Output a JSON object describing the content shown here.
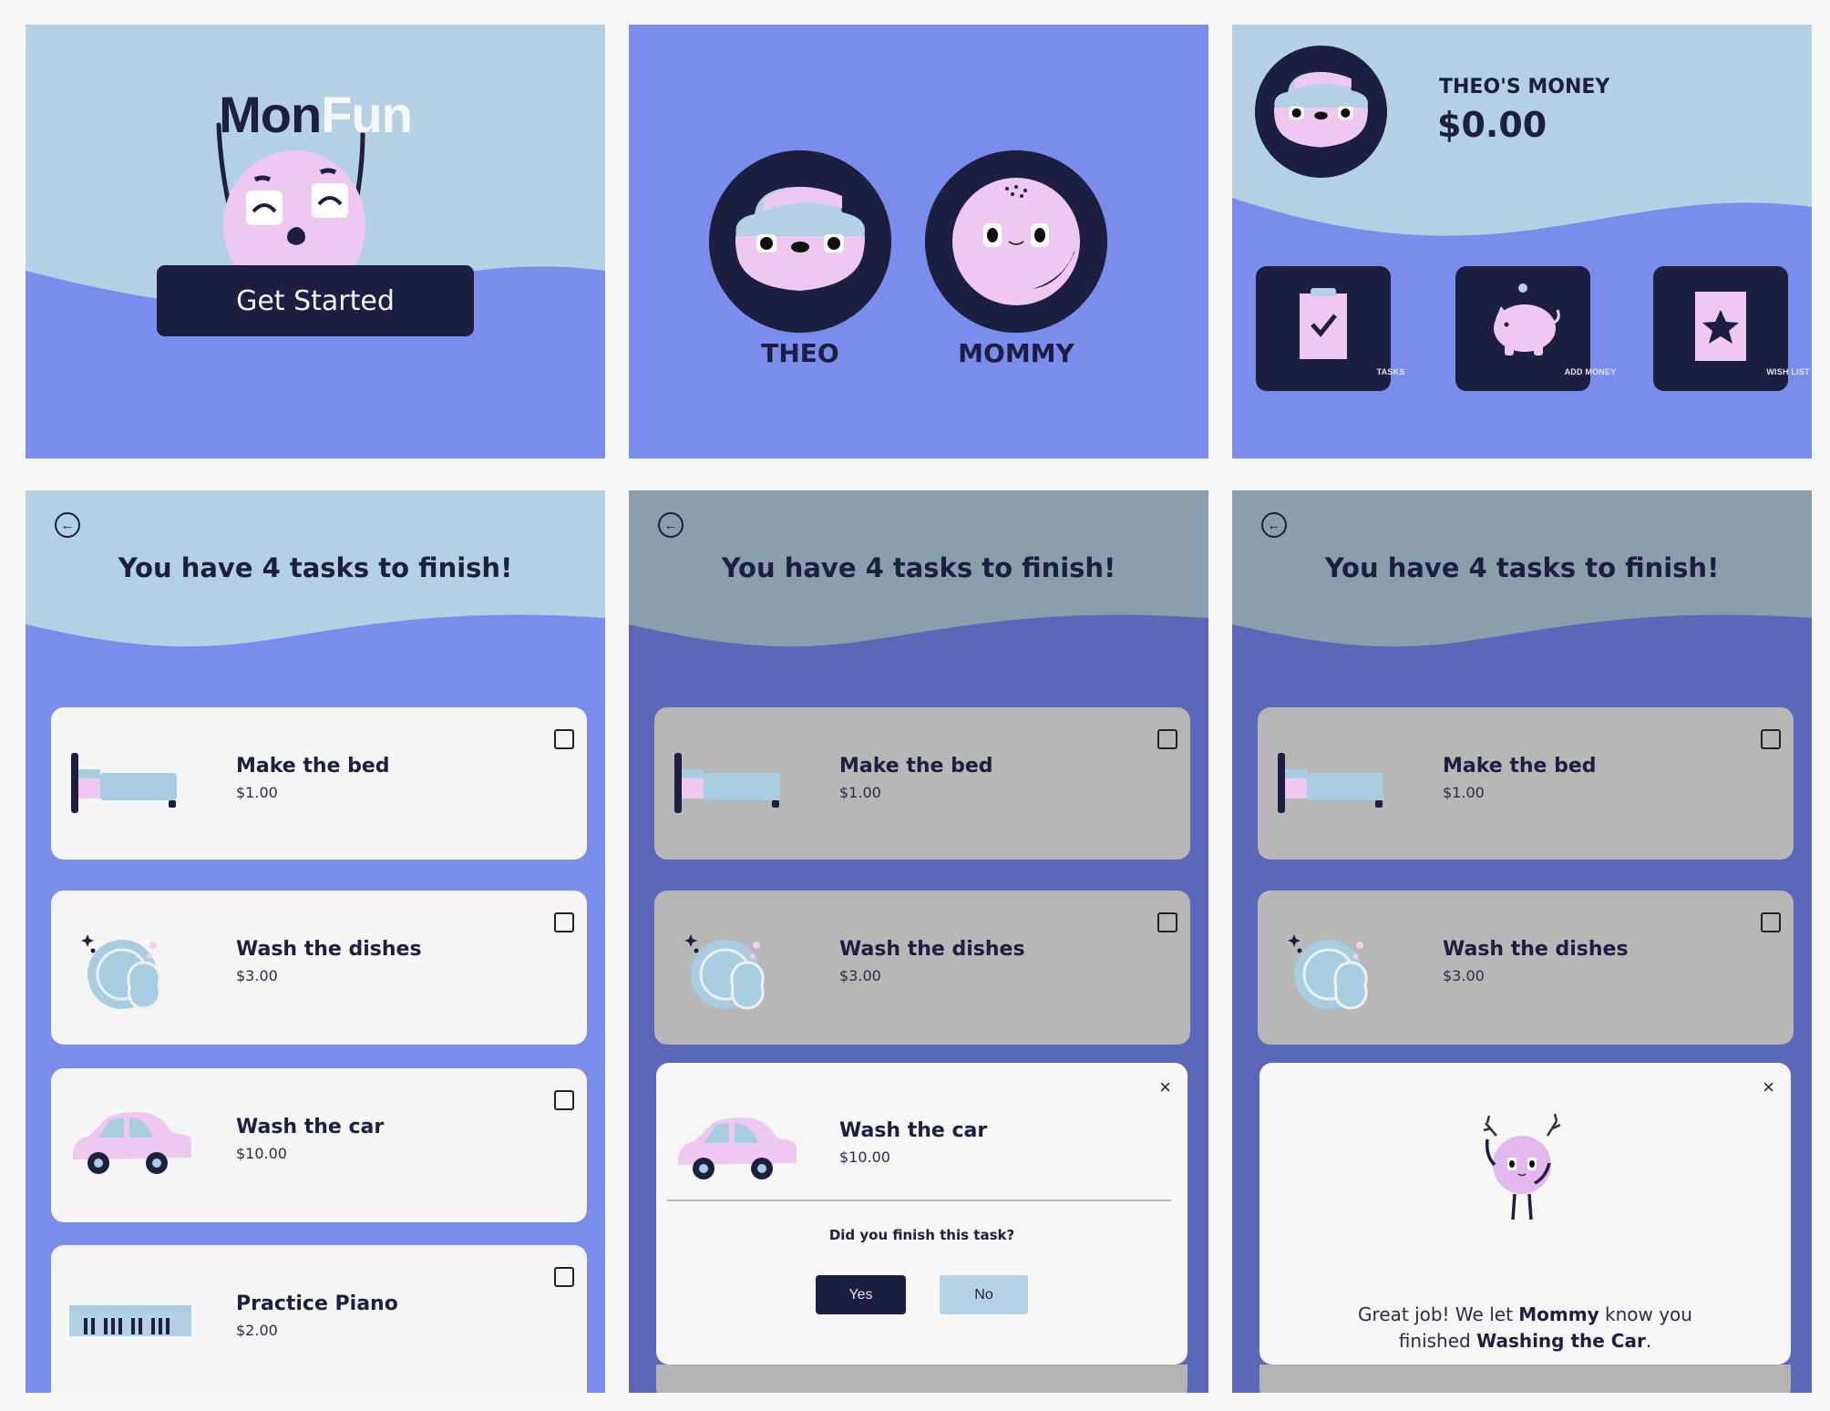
{
  "colors": {
    "light_blue": "#b3d1e3",
    "periwinkle": "#7a8ded",
    "navy": "#1c1f3f",
    "pink": "#efc8f0",
    "card_white": "#f5f5f5",
    "dim_header": "#8a9fab",
    "dim_body": "#5b68b9",
    "dim_card": "#b7b7b7",
    "no_button": "#b6d1e4"
  },
  "screens": {
    "welcome": {
      "logo_part1": "Mon",
      "logo_part2": "Fun",
      "button": "Get Started"
    },
    "profiles": {
      "users": [
        {
          "name": "THEO",
          "avatar": "theo-monster-icon"
        },
        {
          "name": "MOMMY",
          "avatar": "mommy-monster-icon"
        }
      ]
    },
    "home": {
      "money_label": "THEO'S MONEY",
      "money_value": "$0.00",
      "tiles": [
        {
          "label": "TASKS",
          "icon": "clipboard-check-icon"
        },
        {
          "label": "ADD MONEY",
          "icon": "piggy-bank-icon"
        },
        {
          "label": "WISH LIST",
          "icon": "star-card-icon"
        }
      ]
    },
    "tasks": {
      "heading": "You have 4 tasks to finish!",
      "back_icon": "back-arrow-icon",
      "items": [
        {
          "title": "Make the bed",
          "price": "$1.00",
          "icon": "bed-icon",
          "checked": false
        },
        {
          "title": "Wash the dishes",
          "price": "$3.00",
          "icon": "dishes-icon",
          "checked": false
        },
        {
          "title": "Wash the car",
          "price": "$10.00",
          "icon": "car-icon",
          "checked": false
        },
        {
          "title": "Practice Piano",
          "price": "$2.00",
          "icon": "piano-icon",
          "checked": false
        }
      ]
    },
    "confirm_modal": {
      "title": "Wash the car",
      "price": "$10.00",
      "question": "Did you finish this task?",
      "yes": "Yes",
      "no": "No",
      "close": "×"
    },
    "success_modal": {
      "line1_a": "Great job! We let ",
      "line1_b": "Mommy",
      "line1_c": " know you",
      "line2_a": "finished ",
      "line2_b": "Washing the Car",
      "line2_c": ".",
      "close": "×"
    }
  }
}
